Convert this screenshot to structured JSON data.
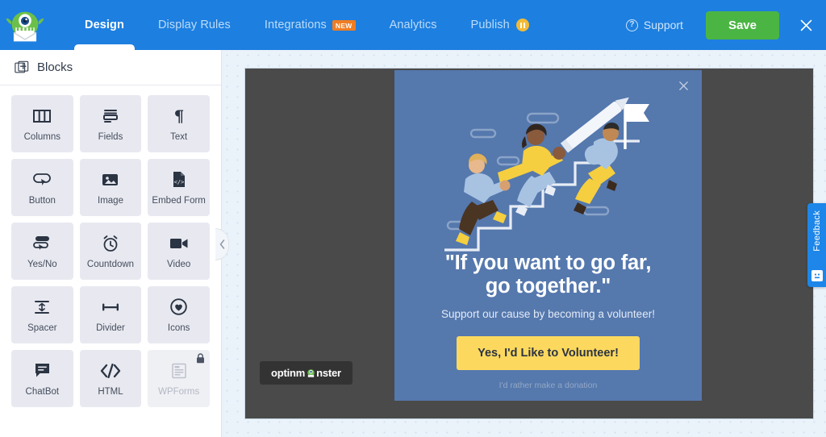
{
  "app": {
    "brand": "OptinMonster",
    "logo_icon": "monster-mascot-icon"
  },
  "topbar": {
    "tabs": [
      {
        "label": "Design",
        "active": true
      },
      {
        "label": "Display Rules",
        "active": false
      },
      {
        "label": "Integrations",
        "active": false,
        "badge": "NEW"
      },
      {
        "label": "Analytics",
        "active": false
      },
      {
        "label": "Publish",
        "active": false,
        "status_icon": "pause-circle-icon"
      }
    ],
    "support_label": "Support",
    "support_icon": "help-circle-icon",
    "save_label": "Save",
    "close_icon": "close-icon",
    "accent_color": "#1d7fe0",
    "save_color": "#4bb543",
    "badge_color": "#f07d21"
  },
  "sidebar": {
    "header": {
      "title": "Blocks",
      "icon": "blocks-add-icon"
    },
    "blocks": [
      {
        "label": "Columns",
        "icon": "columns-icon",
        "locked": false
      },
      {
        "label": "Fields",
        "icon": "fields-icon",
        "locked": false
      },
      {
        "label": "Text",
        "icon": "paragraph-icon",
        "locked": false
      },
      {
        "label": "Button",
        "icon": "button-icon",
        "locked": false
      },
      {
        "label": "Image",
        "icon": "image-icon",
        "locked": false
      },
      {
        "label": "Embed Form",
        "icon": "embed-form-icon",
        "locked": false
      },
      {
        "label": "Yes/No",
        "icon": "yes-no-icon",
        "locked": false
      },
      {
        "label": "Countdown",
        "icon": "alarm-clock-icon",
        "locked": false
      },
      {
        "label": "Video",
        "icon": "video-camera-icon",
        "locked": false
      },
      {
        "label": "Spacer",
        "icon": "spacer-icon",
        "locked": false
      },
      {
        "label": "Divider",
        "icon": "divider-icon",
        "locked": false
      },
      {
        "label": "Icons",
        "icon": "heart-circle-icon",
        "locked": false
      },
      {
        "label": "ChatBot",
        "icon": "chat-bubble-icon",
        "locked": false
      },
      {
        "label": "HTML",
        "icon": "code-icon",
        "locked": false
      },
      {
        "label": "WPForms",
        "icon": "wpforms-icon",
        "locked": true,
        "lock_icon": "lock-icon"
      }
    ],
    "collapse_icon": "chevron-left-icon"
  },
  "canvas": {
    "popup": {
      "close_icon": "close-icon",
      "illustration": "people-climbing-stairs-illustration",
      "headline_line1": "\"If you want to go far,",
      "headline_line2": "go together.\"",
      "subhead": "Support our cause by becoming a volunteer!",
      "cta_label": "Yes, I'd Like to Volunteer!",
      "secondary_link": "I'd rather make a donation",
      "background_color": "#5578ad",
      "cta_color": "#fcd95e"
    },
    "watermark": {
      "text_before": "optinm",
      "text_after": "nster",
      "icon": "monster-mascot-icon"
    }
  },
  "feedback": {
    "label": "Feedback",
    "icon": "feedback-face-icon"
  }
}
